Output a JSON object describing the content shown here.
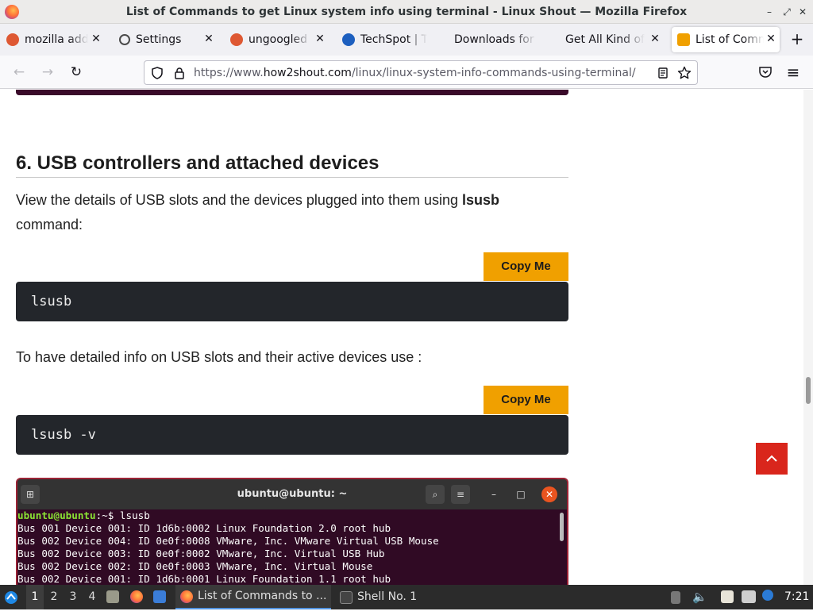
{
  "window": {
    "title": "List of Commands to get Linux system info using terminal - Linux Shout — Mozilla Firefox",
    "minimize": "–",
    "maximize": "⤢",
    "close": "✕"
  },
  "tabs": [
    {
      "label": "mozilla addons",
      "favicon_color": "#de5833",
      "active": false
    },
    {
      "label": "Settings",
      "favicon_color": "#4a4a4a",
      "active": false
    },
    {
      "label": "ungoogled chromium",
      "favicon_color": "#de5833",
      "active": false
    },
    {
      "label": "TechSpot | Tech",
      "favicon_color": "#1d5fbf",
      "active": false
    },
    {
      "label": "Downloads for",
      "favicon_color": "",
      "active": false
    },
    {
      "label": "Get All Kind of",
      "favicon_color": "",
      "active": false
    },
    {
      "label": "List of Commands",
      "favicon_color": "#f0a000",
      "active": true
    }
  ],
  "tab_close": "✕",
  "new_tab": "+",
  "nav": {
    "back": "←",
    "forward": "→",
    "reload": "↻",
    "url_prefix": "https://www.",
    "url_domain": "how2shout.com",
    "url_path": "/linux/linux-system-info-commands-using-terminal/",
    "menu": "≡"
  },
  "article": {
    "heading": "6. USB controllers and attached devices",
    "para1_text": "View the details of USB slots and the devices plugged into them using ",
    "para1_bold": "lsusb",
    "para1_tail": "command:",
    "copy_label": "Copy Me",
    "code1": "lsusb",
    "para2": "To have detailed info on USB slots and their active devices use :",
    "code2": "lsusb -v",
    "back_to_top": "^"
  },
  "terminal": {
    "title": "ubuntu@ubuntu: ~",
    "prompt_user": "ubuntu@ubuntu",
    "prompt_sep": ":~$ ",
    "command": "lsusb",
    "lines": [
      "Bus 001 Device 001: ID 1d6b:0002 Linux Foundation 2.0 root hub",
      "Bus 002 Device 004: ID 0e0f:0008 VMware, Inc. VMware Virtual USB Mouse",
      "Bus 002 Device 003: ID 0e0f:0002 VMware, Inc. Virtual USB Hub",
      "Bus 002 Device 002: ID 0e0f:0003 VMware, Inc. Virtual Mouse",
      "Bus 002 Device 001: ID 1d6b:0001 Linux Foundation 1.1 root hub"
    ]
  },
  "taskbar": {
    "workspaces": [
      "1",
      "2",
      "3",
      "4"
    ],
    "active_workspace": "1",
    "firefox_task": "List of Commands to ...",
    "shell_task": "Shell No. 1",
    "clock": "7:21"
  }
}
